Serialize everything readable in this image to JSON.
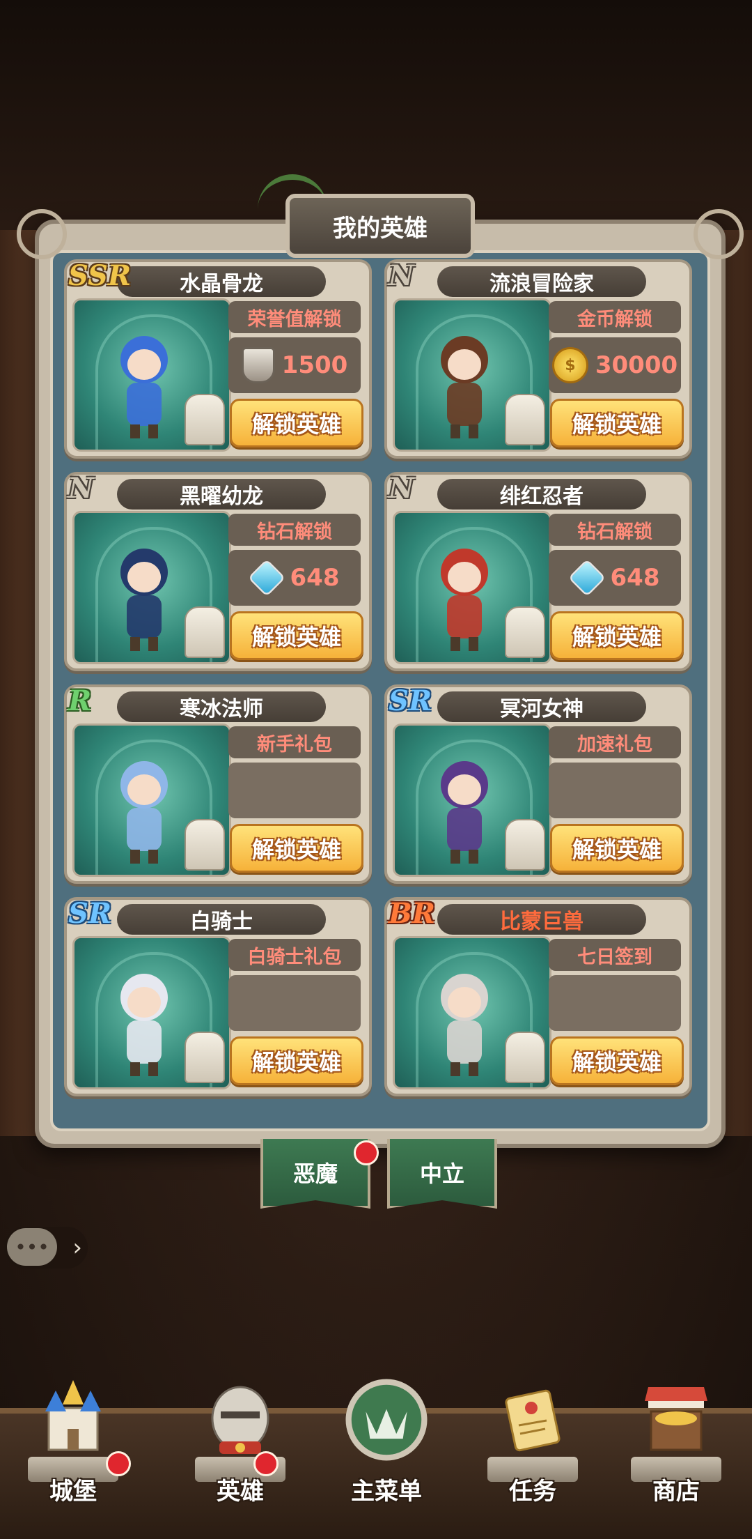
{
  "title": "我的英雄",
  "heroes": [
    {
      "rarity": "SSR",
      "name": "水晶骨龙",
      "method": "荣誉值解锁",
      "cost_icon": "honor-icon",
      "cost": "1500",
      "unlock": "解锁英雄"
    },
    {
      "rarity": "N",
      "name": "流浪冒险家",
      "method": "金币解锁",
      "cost_icon": "coin-icon",
      "cost": "30000",
      "unlock": "解锁英雄"
    },
    {
      "rarity": "N",
      "name": "黑曜幼龙",
      "method": "钻石解锁",
      "cost_icon": "diamond-icon",
      "cost": "648",
      "unlock": "解锁英雄"
    },
    {
      "rarity": "N",
      "name": "绯红忍者",
      "method": "钻石解锁",
      "cost_icon": "diamond-icon",
      "cost": "648",
      "unlock": "解锁英雄"
    },
    {
      "rarity": "R",
      "name": "寒冰法师",
      "method": "新手礼包",
      "cost": "",
      "unlock": "解锁英雄"
    },
    {
      "rarity": "SR",
      "name": "冥河女神",
      "method": "加速礼包",
      "cost": "",
      "unlock": "解锁英雄"
    },
    {
      "rarity": "SR",
      "name": "白骑士",
      "method": "白骑士礼包",
      "cost": "",
      "unlock": "解锁英雄"
    },
    {
      "rarity": "BR",
      "name": "比蒙巨兽",
      "method": "七日签到",
      "cost": "",
      "unlock": "解锁英雄"
    }
  ],
  "factions": [
    {
      "label": "恶魔",
      "has_badge": true
    },
    {
      "label": "中立",
      "has_badge": false
    }
  ],
  "chat": {
    "icon": "chat-icon",
    "arrow": "›"
  },
  "nav": [
    {
      "label": "城堡",
      "icon": "castle-icon",
      "has_badge": true
    },
    {
      "label": "英雄",
      "icon": "knight-helmet-icon",
      "has_badge": true
    },
    {
      "label": "主菜单",
      "icon": "crown-emblem-icon",
      "has_badge": false
    },
    {
      "label": "任务",
      "icon": "scroll-icon",
      "has_badge": false
    },
    {
      "label": "商店",
      "icon": "shop-icon",
      "has_badge": false
    }
  ],
  "colors": {
    "accent": "#f6b23a",
    "panel": "#4f6f7e",
    "card": "#d9cfbd",
    "badge": "#e0262e"
  }
}
